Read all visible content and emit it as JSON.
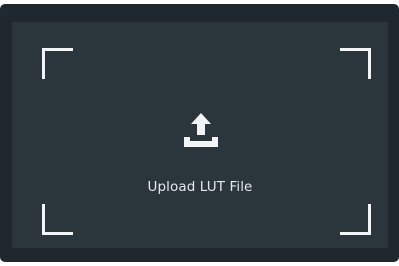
{
  "upload": {
    "label": "Upload LUT File",
    "icon": "upload-icon"
  },
  "colors": {
    "panel_background": "#1f282f",
    "dropzone_background": "#2b353c",
    "foreground": "#f2f4f5",
    "label_text": "#e6e9eb"
  }
}
